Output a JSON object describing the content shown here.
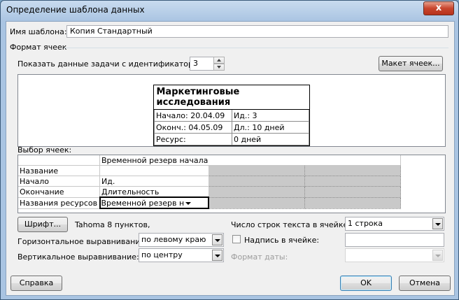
{
  "window": {
    "title": "Определение шаблона данных",
    "close_glyph": "x"
  },
  "template_name": {
    "label": "Имя шаблона:",
    "value": "Копия Стандартный"
  },
  "cell_format": {
    "label": "Формат ячеек"
  },
  "show_task": {
    "label": "Показать данные задачи с идентификатором:",
    "value": "3"
  },
  "cell_layout_button": "Макет ячеек...",
  "card": {
    "title": "Маркетинговые исследования",
    "rows": [
      [
        "Начало:  20.04.09",
        "Ид.:     3"
      ],
      [
        "Оконч.: 04.05.09",
        "Дл.: 10 дней"
      ],
      [
        "Ресурс:",
        "0 дней"
      ]
    ]
  },
  "cell_select": {
    "label": "Выбор ячеек:",
    "rows": [
      [
        "",
        "Временной резерв начала",
        "",
        "",
        ""
      ],
      [
        "Название",
        "",
        "",
        "",
        ""
      ],
      [
        "Начало",
        "Ид.",
        "",
        "",
        ""
      ],
      [
        "Окончание",
        "Длительность",
        "",
        "",
        ""
      ],
      [
        "Названия ресурсов",
        "Временной резерв н",
        "",
        "",
        ""
      ]
    ]
  },
  "font_button": "Шрифт...",
  "font_value": "Tahoma 8 пунктов,",
  "lines_label": "Число строк текста в ячейке:",
  "lines_value": "1 строка",
  "h_align": {
    "label": "Горизонтальное выравнивание:",
    "value": "по левому краю"
  },
  "caption_checkbox": {
    "label": "Надпись в ячейке:",
    "checked": false
  },
  "v_align": {
    "label": "Вертикальное выравнивание:",
    "value": "по центру"
  },
  "date_format": {
    "label": "Формат даты:",
    "value": ""
  },
  "help_button": "Справка",
  "ok_button": "OK",
  "cancel_button": "Отмена"
}
